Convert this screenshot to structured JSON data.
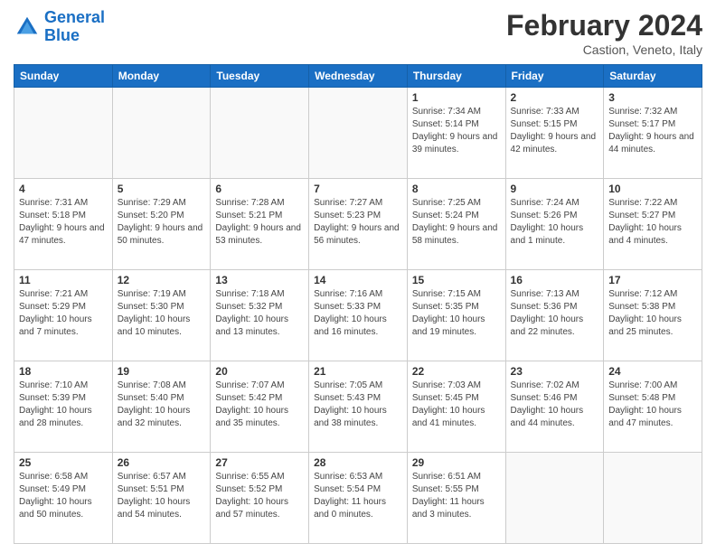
{
  "header": {
    "logo_general": "General",
    "logo_blue": "Blue",
    "title": "February 2024",
    "location": "Castion, Veneto, Italy"
  },
  "days_of_week": [
    "Sunday",
    "Monday",
    "Tuesday",
    "Wednesday",
    "Thursday",
    "Friday",
    "Saturday"
  ],
  "weeks": [
    [
      {
        "day": "",
        "sunrise": "",
        "sunset": "",
        "daylight": "",
        "empty": true
      },
      {
        "day": "",
        "sunrise": "",
        "sunset": "",
        "daylight": "",
        "empty": true
      },
      {
        "day": "",
        "sunrise": "",
        "sunset": "",
        "daylight": "",
        "empty": true
      },
      {
        "day": "",
        "sunrise": "",
        "sunset": "",
        "daylight": "",
        "empty": true
      },
      {
        "day": "1",
        "sunrise": "Sunrise: 7:34 AM",
        "sunset": "Sunset: 5:14 PM",
        "daylight": "Daylight: 9 hours and 39 minutes.",
        "empty": false
      },
      {
        "day": "2",
        "sunrise": "Sunrise: 7:33 AM",
        "sunset": "Sunset: 5:15 PM",
        "daylight": "Daylight: 9 hours and 42 minutes.",
        "empty": false
      },
      {
        "day": "3",
        "sunrise": "Sunrise: 7:32 AM",
        "sunset": "Sunset: 5:17 PM",
        "daylight": "Daylight: 9 hours and 44 minutes.",
        "empty": false
      }
    ],
    [
      {
        "day": "4",
        "sunrise": "Sunrise: 7:31 AM",
        "sunset": "Sunset: 5:18 PM",
        "daylight": "Daylight: 9 hours and 47 minutes.",
        "empty": false
      },
      {
        "day": "5",
        "sunrise": "Sunrise: 7:29 AM",
        "sunset": "Sunset: 5:20 PM",
        "daylight": "Daylight: 9 hours and 50 minutes.",
        "empty": false
      },
      {
        "day": "6",
        "sunrise": "Sunrise: 7:28 AM",
        "sunset": "Sunset: 5:21 PM",
        "daylight": "Daylight: 9 hours and 53 minutes.",
        "empty": false
      },
      {
        "day": "7",
        "sunrise": "Sunrise: 7:27 AM",
        "sunset": "Sunset: 5:23 PM",
        "daylight": "Daylight: 9 hours and 56 minutes.",
        "empty": false
      },
      {
        "day": "8",
        "sunrise": "Sunrise: 7:25 AM",
        "sunset": "Sunset: 5:24 PM",
        "daylight": "Daylight: 9 hours and 58 minutes.",
        "empty": false
      },
      {
        "day": "9",
        "sunrise": "Sunrise: 7:24 AM",
        "sunset": "Sunset: 5:26 PM",
        "daylight": "Daylight: 10 hours and 1 minute.",
        "empty": false
      },
      {
        "day": "10",
        "sunrise": "Sunrise: 7:22 AM",
        "sunset": "Sunset: 5:27 PM",
        "daylight": "Daylight: 10 hours and 4 minutes.",
        "empty": false
      }
    ],
    [
      {
        "day": "11",
        "sunrise": "Sunrise: 7:21 AM",
        "sunset": "Sunset: 5:29 PM",
        "daylight": "Daylight: 10 hours and 7 minutes.",
        "empty": false
      },
      {
        "day": "12",
        "sunrise": "Sunrise: 7:19 AM",
        "sunset": "Sunset: 5:30 PM",
        "daylight": "Daylight: 10 hours and 10 minutes.",
        "empty": false
      },
      {
        "day": "13",
        "sunrise": "Sunrise: 7:18 AM",
        "sunset": "Sunset: 5:32 PM",
        "daylight": "Daylight: 10 hours and 13 minutes.",
        "empty": false
      },
      {
        "day": "14",
        "sunrise": "Sunrise: 7:16 AM",
        "sunset": "Sunset: 5:33 PM",
        "daylight": "Daylight: 10 hours and 16 minutes.",
        "empty": false
      },
      {
        "day": "15",
        "sunrise": "Sunrise: 7:15 AM",
        "sunset": "Sunset: 5:35 PM",
        "daylight": "Daylight: 10 hours and 19 minutes.",
        "empty": false
      },
      {
        "day": "16",
        "sunrise": "Sunrise: 7:13 AM",
        "sunset": "Sunset: 5:36 PM",
        "daylight": "Daylight: 10 hours and 22 minutes.",
        "empty": false
      },
      {
        "day": "17",
        "sunrise": "Sunrise: 7:12 AM",
        "sunset": "Sunset: 5:38 PM",
        "daylight": "Daylight: 10 hours and 25 minutes.",
        "empty": false
      }
    ],
    [
      {
        "day": "18",
        "sunrise": "Sunrise: 7:10 AM",
        "sunset": "Sunset: 5:39 PM",
        "daylight": "Daylight: 10 hours and 28 minutes.",
        "empty": false
      },
      {
        "day": "19",
        "sunrise": "Sunrise: 7:08 AM",
        "sunset": "Sunset: 5:40 PM",
        "daylight": "Daylight: 10 hours and 32 minutes.",
        "empty": false
      },
      {
        "day": "20",
        "sunrise": "Sunrise: 7:07 AM",
        "sunset": "Sunset: 5:42 PM",
        "daylight": "Daylight: 10 hours and 35 minutes.",
        "empty": false
      },
      {
        "day": "21",
        "sunrise": "Sunrise: 7:05 AM",
        "sunset": "Sunset: 5:43 PM",
        "daylight": "Daylight: 10 hours and 38 minutes.",
        "empty": false
      },
      {
        "day": "22",
        "sunrise": "Sunrise: 7:03 AM",
        "sunset": "Sunset: 5:45 PM",
        "daylight": "Daylight: 10 hours and 41 minutes.",
        "empty": false
      },
      {
        "day": "23",
        "sunrise": "Sunrise: 7:02 AM",
        "sunset": "Sunset: 5:46 PM",
        "daylight": "Daylight: 10 hours and 44 minutes.",
        "empty": false
      },
      {
        "day": "24",
        "sunrise": "Sunrise: 7:00 AM",
        "sunset": "Sunset: 5:48 PM",
        "daylight": "Daylight: 10 hours and 47 minutes.",
        "empty": false
      }
    ],
    [
      {
        "day": "25",
        "sunrise": "Sunrise: 6:58 AM",
        "sunset": "Sunset: 5:49 PM",
        "daylight": "Daylight: 10 hours and 50 minutes.",
        "empty": false
      },
      {
        "day": "26",
        "sunrise": "Sunrise: 6:57 AM",
        "sunset": "Sunset: 5:51 PM",
        "daylight": "Daylight: 10 hours and 54 minutes.",
        "empty": false
      },
      {
        "day": "27",
        "sunrise": "Sunrise: 6:55 AM",
        "sunset": "Sunset: 5:52 PM",
        "daylight": "Daylight: 10 hours and 57 minutes.",
        "empty": false
      },
      {
        "day": "28",
        "sunrise": "Sunrise: 6:53 AM",
        "sunset": "Sunset: 5:54 PM",
        "daylight": "Daylight: 11 hours and 0 minutes.",
        "empty": false
      },
      {
        "day": "29",
        "sunrise": "Sunrise: 6:51 AM",
        "sunset": "Sunset: 5:55 PM",
        "daylight": "Daylight: 11 hours and 3 minutes.",
        "empty": false
      },
      {
        "day": "",
        "sunrise": "",
        "sunset": "",
        "daylight": "",
        "empty": true
      },
      {
        "day": "",
        "sunrise": "",
        "sunset": "",
        "daylight": "",
        "empty": true
      }
    ]
  ]
}
